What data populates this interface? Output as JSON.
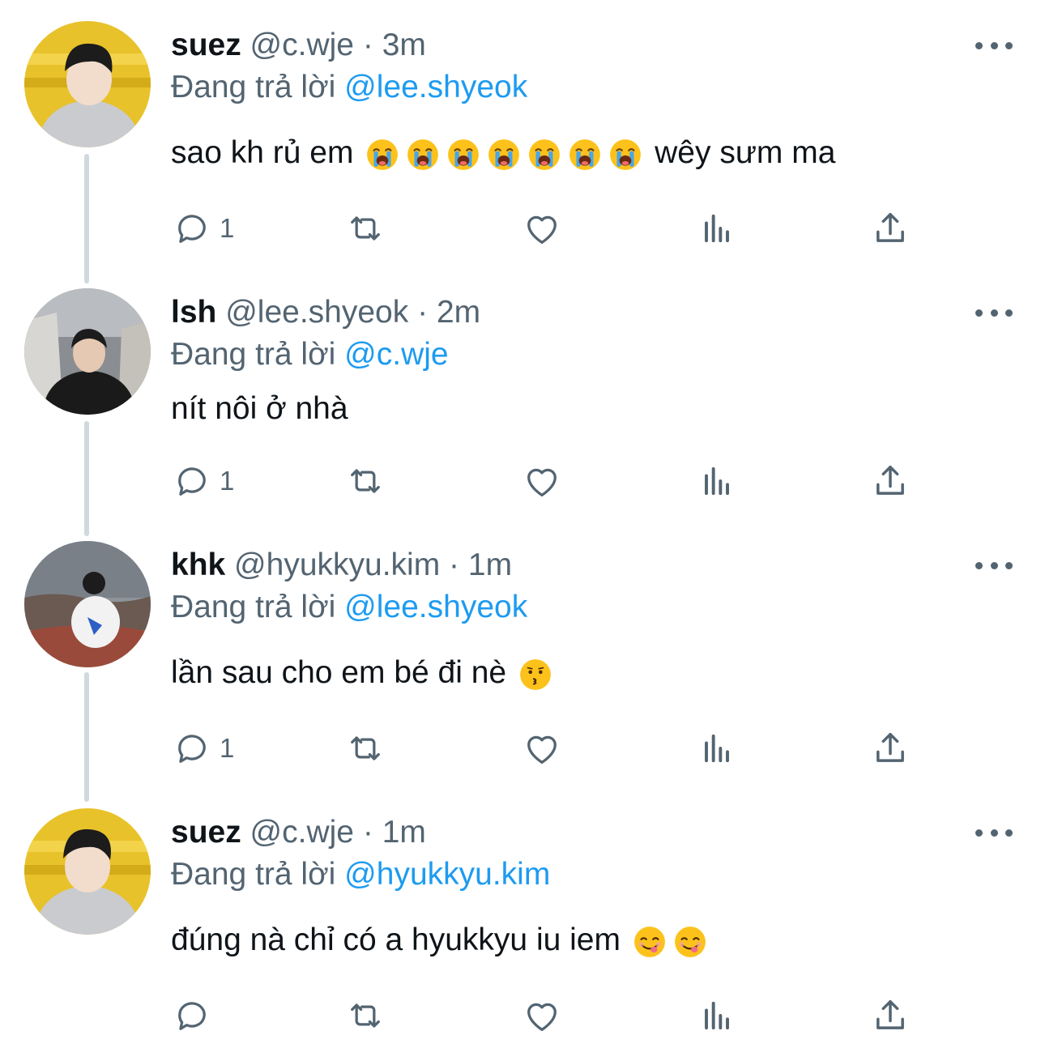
{
  "tweets": [
    {
      "name": "suez",
      "handle": "@c.wje",
      "sep": "·",
      "time": "3m",
      "reply_prefix": "Đang trả lời",
      "reply_to": "@lee.shyeok",
      "text_before": "sao kh rủ em",
      "text_after": "wêy sưm ma",
      "emoji": "crying-face",
      "emoji_count": 7,
      "reply_count": "1",
      "avatar": "suez-avatar"
    },
    {
      "name": "lsh",
      "handle": "@lee.shyeok",
      "sep": "·",
      "time": "2m",
      "reply_prefix": "Đang trả lời",
      "reply_to": "@c.wje",
      "text_before": "nít nôi ở nhà",
      "text_after": "",
      "reply_count": "1",
      "avatar": "lsh-avatar"
    },
    {
      "name": "khk",
      "handle": "@hyukkyu.kim",
      "sep": "·",
      "time": "1m",
      "reply_prefix": "Đang trả lời",
      "reply_to": "@lee.shyeok",
      "text_before": "lần sau cho em bé đi nè",
      "text_after": "",
      "emoji": "kissing-face",
      "emoji_count": 1,
      "reply_count": "1",
      "avatar": "khk-avatar"
    },
    {
      "name": "suez",
      "handle": "@c.wje",
      "sep": "·",
      "time": "1m",
      "reply_prefix": "Đang trả lời",
      "reply_to": "@hyukkyu.kim",
      "text_before": "đúng nà chỉ có a hyukkyu iu iem",
      "text_after": "",
      "emoji": "yum-face",
      "emoji_count": 2,
      "reply_count": "",
      "avatar": "suez-avatar"
    }
  ],
  "icons": [
    "reply-icon",
    "retweet-icon",
    "like-icon",
    "views-icon",
    "share-icon",
    "more-icon"
  ],
  "colors": {
    "text": "#0f1419",
    "secondary": "#536471",
    "link": "#1d9bf0",
    "thread_line": "#cfd9de"
  }
}
